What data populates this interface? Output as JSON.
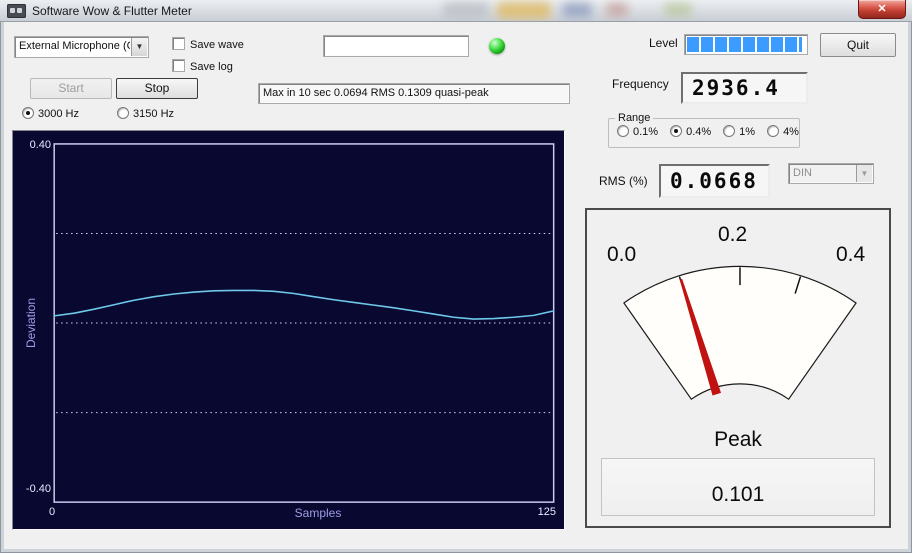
{
  "window": {
    "title": "Software Wow & Flutter Meter",
    "close_label": "✕"
  },
  "toolbar": {
    "input_device": {
      "value": "External Microphone (C"
    },
    "save_wave_label": "Save wave",
    "save_log_label": "Save log",
    "filename_value": "",
    "level_label": "Level",
    "level_bar": {
      "full_segments": 8,
      "partial_segment": true,
      "segment_color": "#3b9bfe"
    },
    "quit_label": "Quit"
  },
  "controls": {
    "start_label": "Start",
    "stop_label": "Stop",
    "freq_select": {
      "options": [
        "3000 Hz",
        "3150 Hz"
      ],
      "selected": "3000 Hz"
    },
    "status_text": "Max in 10 sec 0.0694 RMS 0.1309 quasi-peak"
  },
  "readouts": {
    "frequency_label": "Frequency",
    "frequency_value": "2936.4",
    "range": {
      "label": "Range",
      "options": [
        "0.1%",
        "0.4%",
        "1%",
        "4%"
      ],
      "selected": "0.4%"
    },
    "rms_label": "RMS (%)",
    "rms_value": "0.0668",
    "weighting_value": "DIN"
  },
  "meter": {
    "min": 0.0,
    "max": 0.4,
    "value": 0.101,
    "ticks": [
      0.1,
      0.2,
      0.3
    ],
    "scale_labels": [
      "0.0",
      "0.2",
      "0.4"
    ],
    "needle_color": "#c11212",
    "face_color": "#fffefa",
    "peak_label": "Peak",
    "peak_value": "0.101"
  },
  "chart_data": {
    "type": "line",
    "title": "",
    "xlabel": "Samples",
    "ylabel": "Deviation",
    "xlim": [
      0,
      125
    ],
    "ylim": [
      -0.4,
      0.4
    ],
    "x_tick_labels": [
      "0",
      "125"
    ],
    "y_tick_labels": [
      "0.40",
      "-0.40"
    ],
    "gridlines_y": [
      0.2,
      0.0,
      -0.2
    ],
    "legend": "off",
    "background": "#080830",
    "line_color": "#6fc8ea",
    "frame_color": "#ccccf0",
    "grid_color": "#d8d8f0",
    "x": [
      0,
      5,
      10,
      15,
      20,
      25,
      30,
      35,
      40,
      45,
      50,
      55,
      60,
      65,
      70,
      75,
      80,
      85,
      90,
      95,
      100,
      105,
      110,
      115,
      120,
      125
    ],
    "y": [
      0.016,
      0.022,
      0.031,
      0.041,
      0.051,
      0.059,
      0.065,
      0.069,
      0.072,
      0.073,
      0.073,
      0.071,
      0.066,
      0.059,
      0.052,
      0.046,
      0.04,
      0.034,
      0.027,
      0.02,
      0.013,
      0.009,
      0.01,
      0.013,
      0.017,
      0.027
    ]
  },
  "colors": {
    "accent_blue": "#3b9bfe",
    "led_green": "#12a312",
    "needle_red": "#c11212",
    "chart_bg": "#080830"
  }
}
